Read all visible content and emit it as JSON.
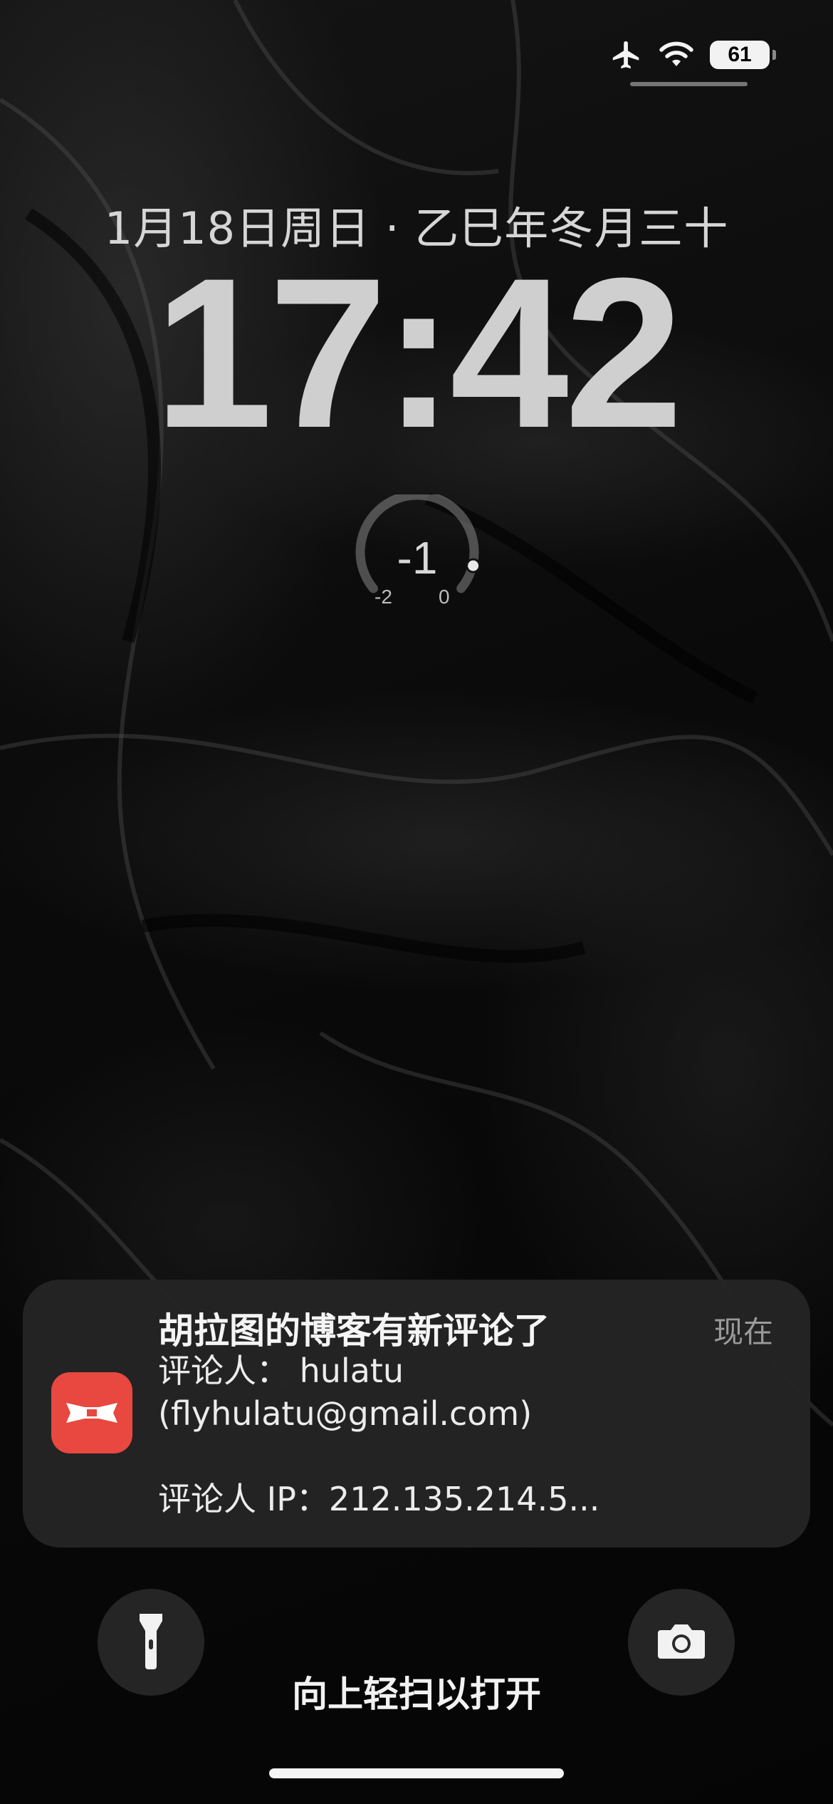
{
  "status_bar": {
    "airplane_icon": "airplane-icon",
    "wifi_icon": "wifi-icon",
    "battery_level": "61"
  },
  "lock_screen": {
    "date": "1月18日周日 · 乙巳年冬月三十",
    "time": "17:42"
  },
  "widget": {
    "value": "-1",
    "min_label": "-2",
    "max_label": "0",
    "level_fraction": 0.5
  },
  "notification": {
    "title": "胡拉图的博客有新评论了",
    "time": "现在",
    "lines": [
      "评论人： hulatu",
      "(flyhulatu@gmail.com)",
      "",
      "评论人 IP：212.135.214.5..."
    ],
    "app_icon": "blog-app-icon",
    "accent": "#e8483f"
  },
  "controls": {
    "flashlight_icon": "flashlight-icon",
    "camera_icon": "camera-icon",
    "swipe_hint": "向上轻扫以打开"
  }
}
